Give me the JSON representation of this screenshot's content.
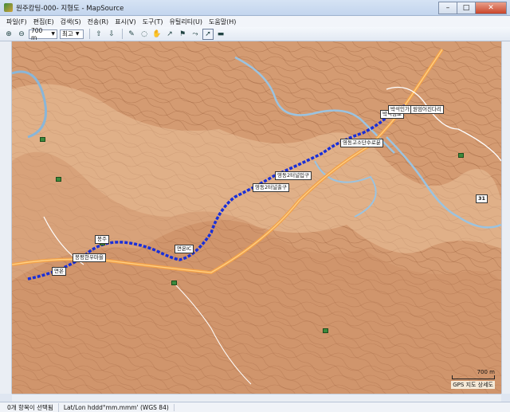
{
  "window": {
    "title": "원주캉팅-000- 지형도 - MapSource",
    "min": "–",
    "max": "□",
    "close": "✕"
  },
  "menu": [
    "파일(F)",
    "편집(E)",
    "검색(S)",
    "전송(R)",
    "표시(V)",
    "도구(T)",
    "유틸리티(U)",
    "도움말(H)"
  ],
  "toolbar": {
    "zoom_value": "700 m",
    "detail_value": "최고"
  },
  "map": {
    "labels": [
      {
        "text": "박석임교",
        "id": "bakseok-bridge"
      },
      {
        "text": "박석인가",
        "id": "bakseok-ingga"
      },
      {
        "text": "원엄어진다리",
        "id": "wonkeom-bridge"
      },
      {
        "text": "영동고소단수로분",
        "id": "yeongdong-1"
      },
      {
        "text": "영동2터널입구",
        "id": "yeongdong-tunnel"
      },
      {
        "text": "영동2터널출구",
        "id": "yeongdong-exit"
      },
      {
        "text": "면온IC",
        "id": "myeonon-ic"
      },
      {
        "text": "봉평한우마을",
        "id": "bongpyeong-hanu"
      },
      {
        "text": "면온",
        "id": "myeonon"
      },
      {
        "text": "봉주",
        "id": "bongju"
      }
    ],
    "route_marker": "31",
    "scale": "700 m",
    "gps_detail": "GPS 지도 상세도"
  },
  "status": {
    "selection": "0개 항목이 선택됨",
    "coord_format": "Lat/Lon hddd°mm.mmm' (WGS 84)"
  }
}
